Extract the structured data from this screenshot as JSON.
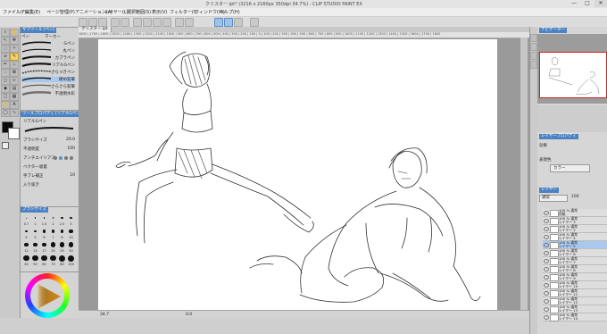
{
  "window": {
    "title": "クリスター.ipt* (3216 x 2160px 350dpi 34.7%) - CLIP STUDIO PAINT EX",
    "minimize": "—",
    "maximize": "□",
    "close": "✕"
  },
  "menu": [
    "ファイル(F)",
    "編集(E)",
    "ページ管理(P)",
    "アニメーション(A)",
    "レイヤー(L)",
    "選択範囲(S)",
    "表示(V)",
    "フィルター(I)",
    "ウィンドウ(W)",
    "ヘルプ(H)"
  ],
  "canvas": {
    "document_tab": "クリスター.ipt",
    "ruler": "1800 | 1700 | 1600 | 1500 | 1400 | 1300 | 1200 | 1100 | 1000 | 900 | 800 | 700 | 600 | 500 | 400 | 300 | 200 | 100 | 0 | 100 | 200 | 300 | 400 | 500 | 600 | 700 | 800 | 900 | 1000 | 1100 | 1200 | 1300 | 1400 | 1500 | 1600 | 1700 | 1800",
    "zoom": "34.7",
    "rotation": "0.0"
  },
  "subtool_panel": {
    "tab": "サブツール [ペン]",
    "group_pen": "ペン",
    "group_marker": "マーカー",
    "brushes": [
      "Gペン",
      "丸ペン",
      "カブラペン",
      "リアルGペン",
      "ざらつきペン",
      "硬め鉛筆",
      "さらさら鉛筆",
      "不透明水彩"
    ],
    "selected_index": 5
  },
  "tool_property": {
    "tab": "ツールプロパティ [リアルGペン]",
    "name": "リアルGペン",
    "rows": [
      {
        "label": "ブラシサイズ",
        "value": "20.0"
      },
      {
        "label": "不透明度",
        "value": "100"
      },
      {
        "label": "アンチエイリアス",
        "value": ""
      },
      {
        "label": "ベクター吸着",
        "value": ""
      },
      {
        "label": "手ブレ補正",
        "value": "10"
      },
      {
        "label": "入り抜き",
        "value": ""
      }
    ]
  },
  "brush_size": {
    "tab": "ブラシサイズ",
    "sizes": [
      "0.7",
      "1",
      "1.5",
      "2",
      "2.5",
      "3",
      "4",
      "5",
      "6",
      "7",
      "8",
      "10",
      "12",
      "15",
      "17",
      "20",
      "25",
      "30",
      "40",
      "50",
      "60",
      "70",
      "80",
      "100"
    ]
  },
  "colors": {
    "main": "#0a0a0a",
    "sub": "#ffffff",
    "accent": "#4a82c4",
    "layer_selected": "#a8c8ee",
    "wheel_indicator": "#cc8a20"
  },
  "navigator": {
    "tab": "ナビゲーター"
  },
  "layer_property": {
    "tab": "レイヤープロパティ",
    "effect_label": "効果",
    "expression_label": "表現色",
    "expression_value": "カラー"
  },
  "layers": {
    "tab": "レイヤー",
    "blend": "通常",
    "opacity": "100",
    "items": [
      {
        "mode": "100 % 通常",
        "name": "用紙"
      },
      {
        "mode": "100 % 通常",
        "name": "レイヤー 3"
      },
      {
        "mode": "100 % 通常",
        "name": "レイヤー 2"
      },
      {
        "mode": "100 % 通常",
        "name": "レイヤー 4"
      },
      {
        "mode": "100 % 通常",
        "name": "レイヤー 5"
      },
      {
        "mode": "100 % 通常",
        "name": "レイヤー 6"
      },
      {
        "mode": "100 % 通常",
        "name": "レイヤー 7"
      },
      {
        "mode": "100 % 通常",
        "name": "レイヤー 8"
      },
      {
        "mode": "100 % 通常",
        "name": "レイヤー 9"
      },
      {
        "mode": "100 % 通常",
        "name": "レイヤー 10"
      },
      {
        "mode": "100 % 通常",
        "name": "レイヤー 11"
      },
      {
        "mode": "100 % 通常",
        "name": "レイヤー 12"
      },
      {
        "mode": "100 % 通常",
        "name": "レイヤー 13"
      },
      {
        "mode": "100 % 通常",
        "name": "レイヤー 14"
      }
    ],
    "selected_index": 4
  }
}
